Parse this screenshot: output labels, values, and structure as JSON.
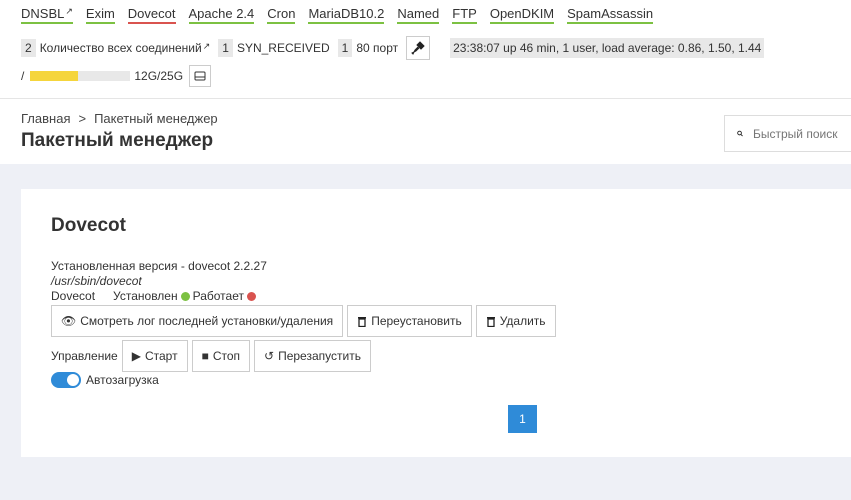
{
  "services": [
    {
      "label": "DNSBL",
      "status": "ok",
      "external": true
    },
    {
      "label": "Exim",
      "status": "ok",
      "external": false
    },
    {
      "label": "Dovecot",
      "status": "bad",
      "external": false
    },
    {
      "label": "Apache 2.4",
      "status": "ok",
      "external": false
    },
    {
      "label": "Cron",
      "status": "ok",
      "external": false
    },
    {
      "label": "MariaDB10.2",
      "status": "ok",
      "external": false
    },
    {
      "label": "Named",
      "status": "ok",
      "external": false
    },
    {
      "label": "FTP",
      "status": "ok",
      "external": false
    },
    {
      "label": "OpenDKIM",
      "status": "ok",
      "external": false
    },
    {
      "label": "SpamAssassin",
      "status": "ok",
      "external": false
    }
  ],
  "stats": {
    "connections_count": "2",
    "connections_label": "Количество всех соединений",
    "syn_count": "1",
    "syn_label": "SYN_RECEIVED",
    "port_count": "1",
    "port_label": "80 порт",
    "uptime": "23:38:07 up 46 min, 1 user, load average: 0.86, 1.50, 1.44"
  },
  "disk": {
    "mount": "/",
    "usage_text": "12G/25G",
    "used_fraction": 0.48
  },
  "breadcrumb": {
    "home": "Главная",
    "separator": ">",
    "current": "Пакетный менеджер"
  },
  "page_title": "Пакетный менеджер",
  "quick_search": {
    "placeholder": "Быстрый поиск"
  },
  "package": {
    "name": "Dovecot",
    "installed_version": "Установленная версия - dovecot 2.2.27",
    "path": "/usr/sbin/dovecot",
    "short_name": "Dovecot",
    "installed_label": "Установлен",
    "running_label": "Работает",
    "buttons": {
      "view_log": "Смотреть лог последней установки/удаления",
      "reinstall": "Переустановить",
      "remove": "Удалить"
    },
    "controls_label": "Управление",
    "controls": {
      "start": "Старт",
      "stop": "Стоп",
      "restart": "Перезапустить"
    },
    "autoload_label": "Автозагрузка",
    "autoload_enabled": true
  },
  "pagination": {
    "current_page": "1"
  },
  "colors": {
    "ok": "#7cc142",
    "bad": "#d9534f",
    "accent": "#2f8bd8",
    "disk_bar": "#f5d53c"
  }
}
